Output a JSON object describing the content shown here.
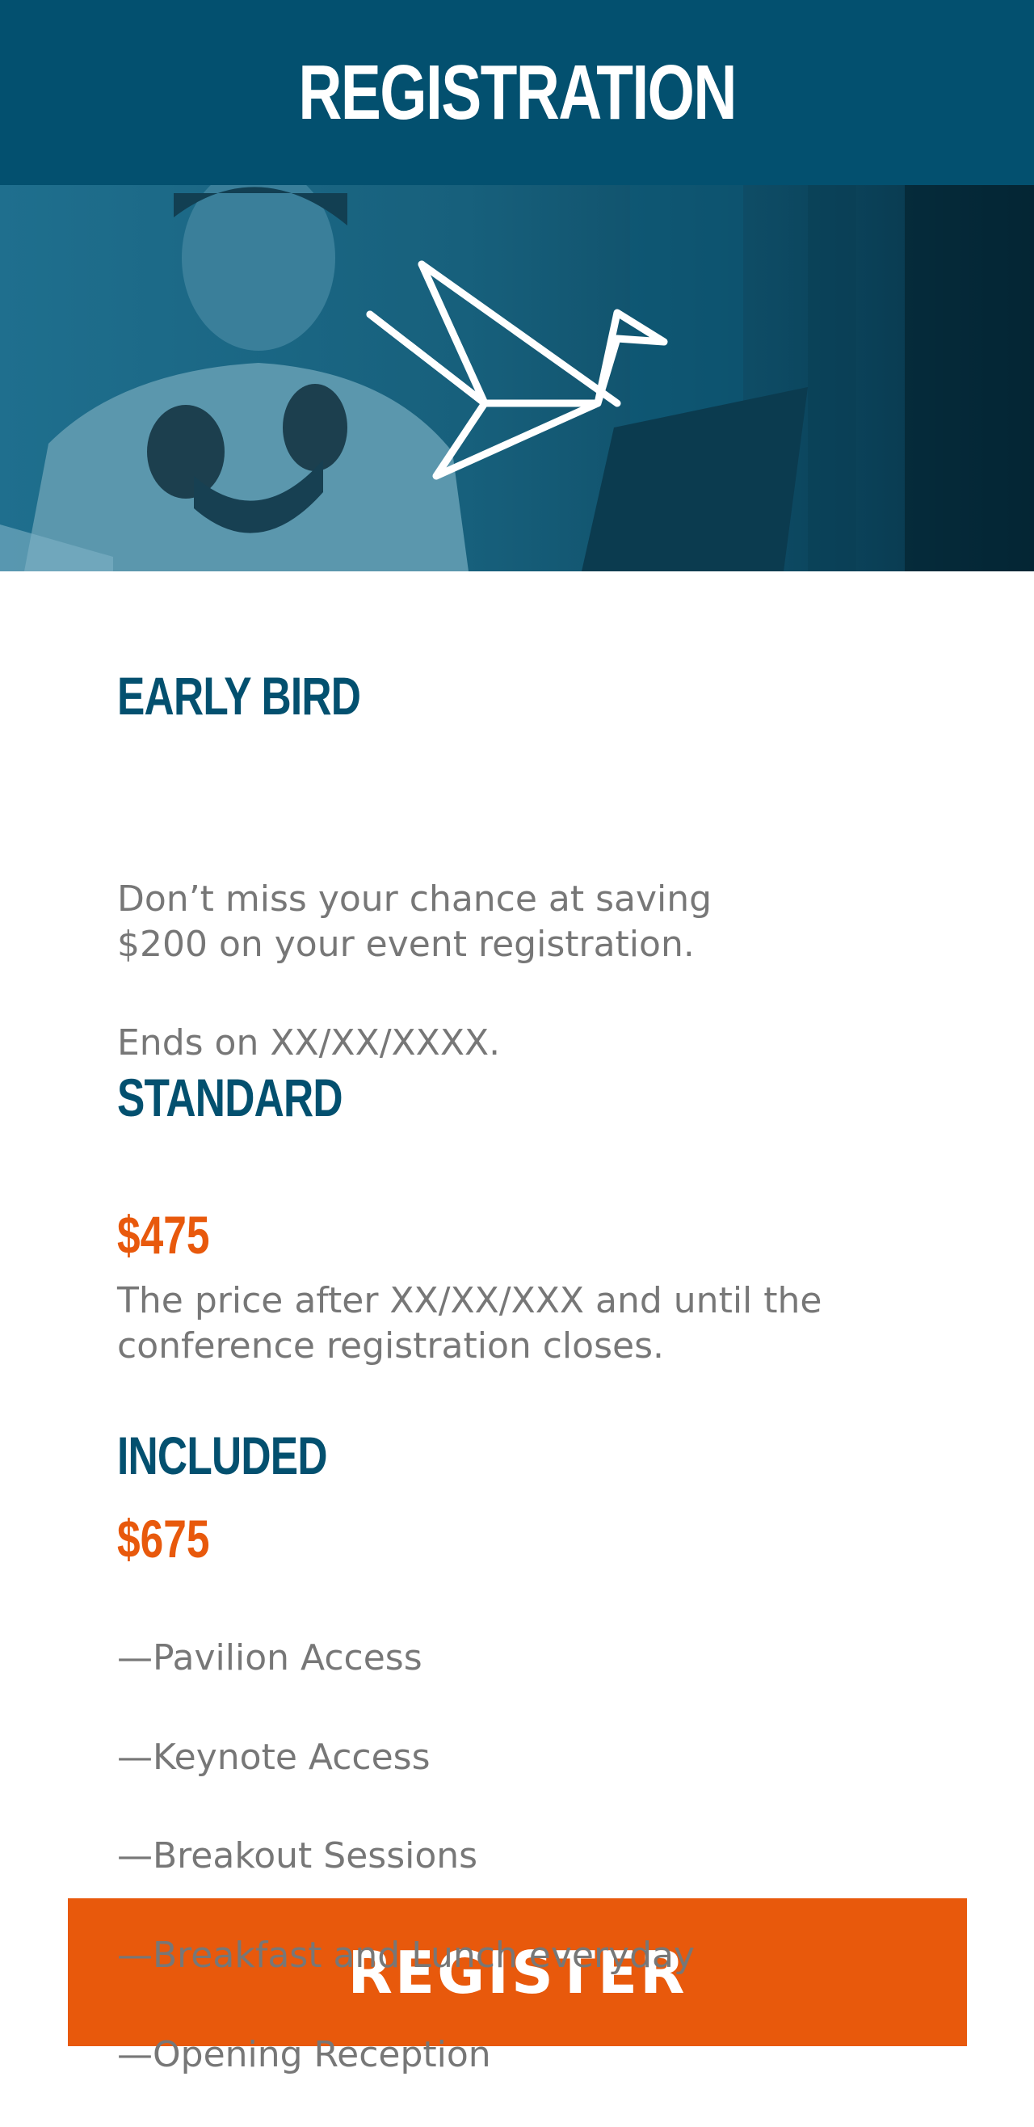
{
  "header": {
    "title": "REGISTRATION"
  },
  "colors": {
    "brand": "#03506f",
    "accent": "#e8590c",
    "body_text": "#777777"
  },
  "hero": {
    "logo_icon": "origami-bird-icon"
  },
  "early_bird": {
    "heading": "EARLY BIRD",
    "description": "Don’t miss your chance at saving\n$200 on your event registration.",
    "ends": "Ends on XX/XX/XXXX."
  },
  "standard": {
    "heading": "STANDARD",
    "price": "$475",
    "description": "The price after XX/XX/XXX and until the\nconference registration closes."
  },
  "included": {
    "heading": "INCLUDED",
    "price": "$675",
    "items": [
      "—Pavilion Access",
      "—Keynote Access",
      "—Breakout Sessions",
      "—Breakfast and Lunch everyday",
      "—Opening Reception"
    ]
  },
  "cta": {
    "label": "REGISTER"
  }
}
